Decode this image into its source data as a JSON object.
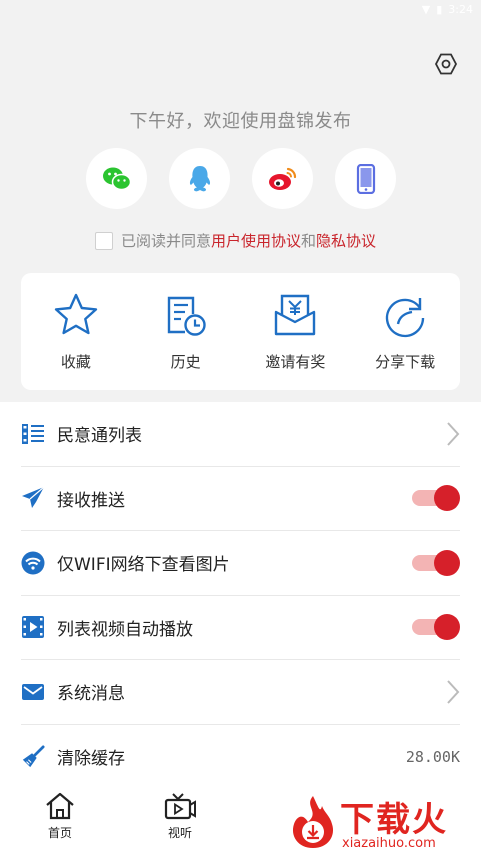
{
  "status_bar": {
    "time": "3:24"
  },
  "greeting": "下午好，欢迎使用盘锦发布",
  "login_options": [
    {
      "name": "wechat",
      "icon": "wechat-icon",
      "color": "#2bc430"
    },
    {
      "name": "qq",
      "icon": "qq-icon",
      "color": "#4aa8e8"
    },
    {
      "name": "weibo",
      "icon": "weibo-icon",
      "color": "#e6162d"
    },
    {
      "name": "phone",
      "icon": "phone-icon",
      "color": "#5b6ee1"
    }
  ],
  "agreement": {
    "prefix": "已阅读并同意",
    "user_agreement": "用户使用协议",
    "conjunction": "和",
    "privacy_policy": "隐私协议"
  },
  "quick_actions": [
    {
      "label": "收藏",
      "icon": "star-icon"
    },
    {
      "label": "历史",
      "icon": "history-icon"
    },
    {
      "label": "邀请有奖",
      "icon": "invite-reward-icon"
    },
    {
      "label": "分享下载",
      "icon": "share-icon"
    }
  ],
  "settings": [
    {
      "label": "民意通列表",
      "icon": "list-icon",
      "type": "arrow"
    },
    {
      "label": "接收推送",
      "icon": "paper-plane-icon",
      "type": "toggle",
      "on": true
    },
    {
      "label": "仅WIFI网络下查看图片",
      "icon": "wifi-icon",
      "type": "toggle",
      "on": true
    },
    {
      "label": "列表视频自动播放",
      "icon": "video-icon",
      "type": "toggle",
      "on": true
    },
    {
      "label": "系统消息",
      "icon": "mail-icon",
      "type": "arrow"
    },
    {
      "label": "清除缓存",
      "icon": "broom-icon",
      "type": "value",
      "value": "28.00K"
    }
  ],
  "bottom_nav": [
    {
      "label": "首页",
      "icon": "home-icon"
    },
    {
      "label": "视听",
      "icon": "tv-icon"
    }
  ],
  "watermark": {
    "title": "下载火",
    "subtitle": "xiazaihuo.com"
  },
  "colors": {
    "accent_red": "#c9252c",
    "icon_blue": "#1f6fc4",
    "toggle_red": "#d6202a"
  }
}
